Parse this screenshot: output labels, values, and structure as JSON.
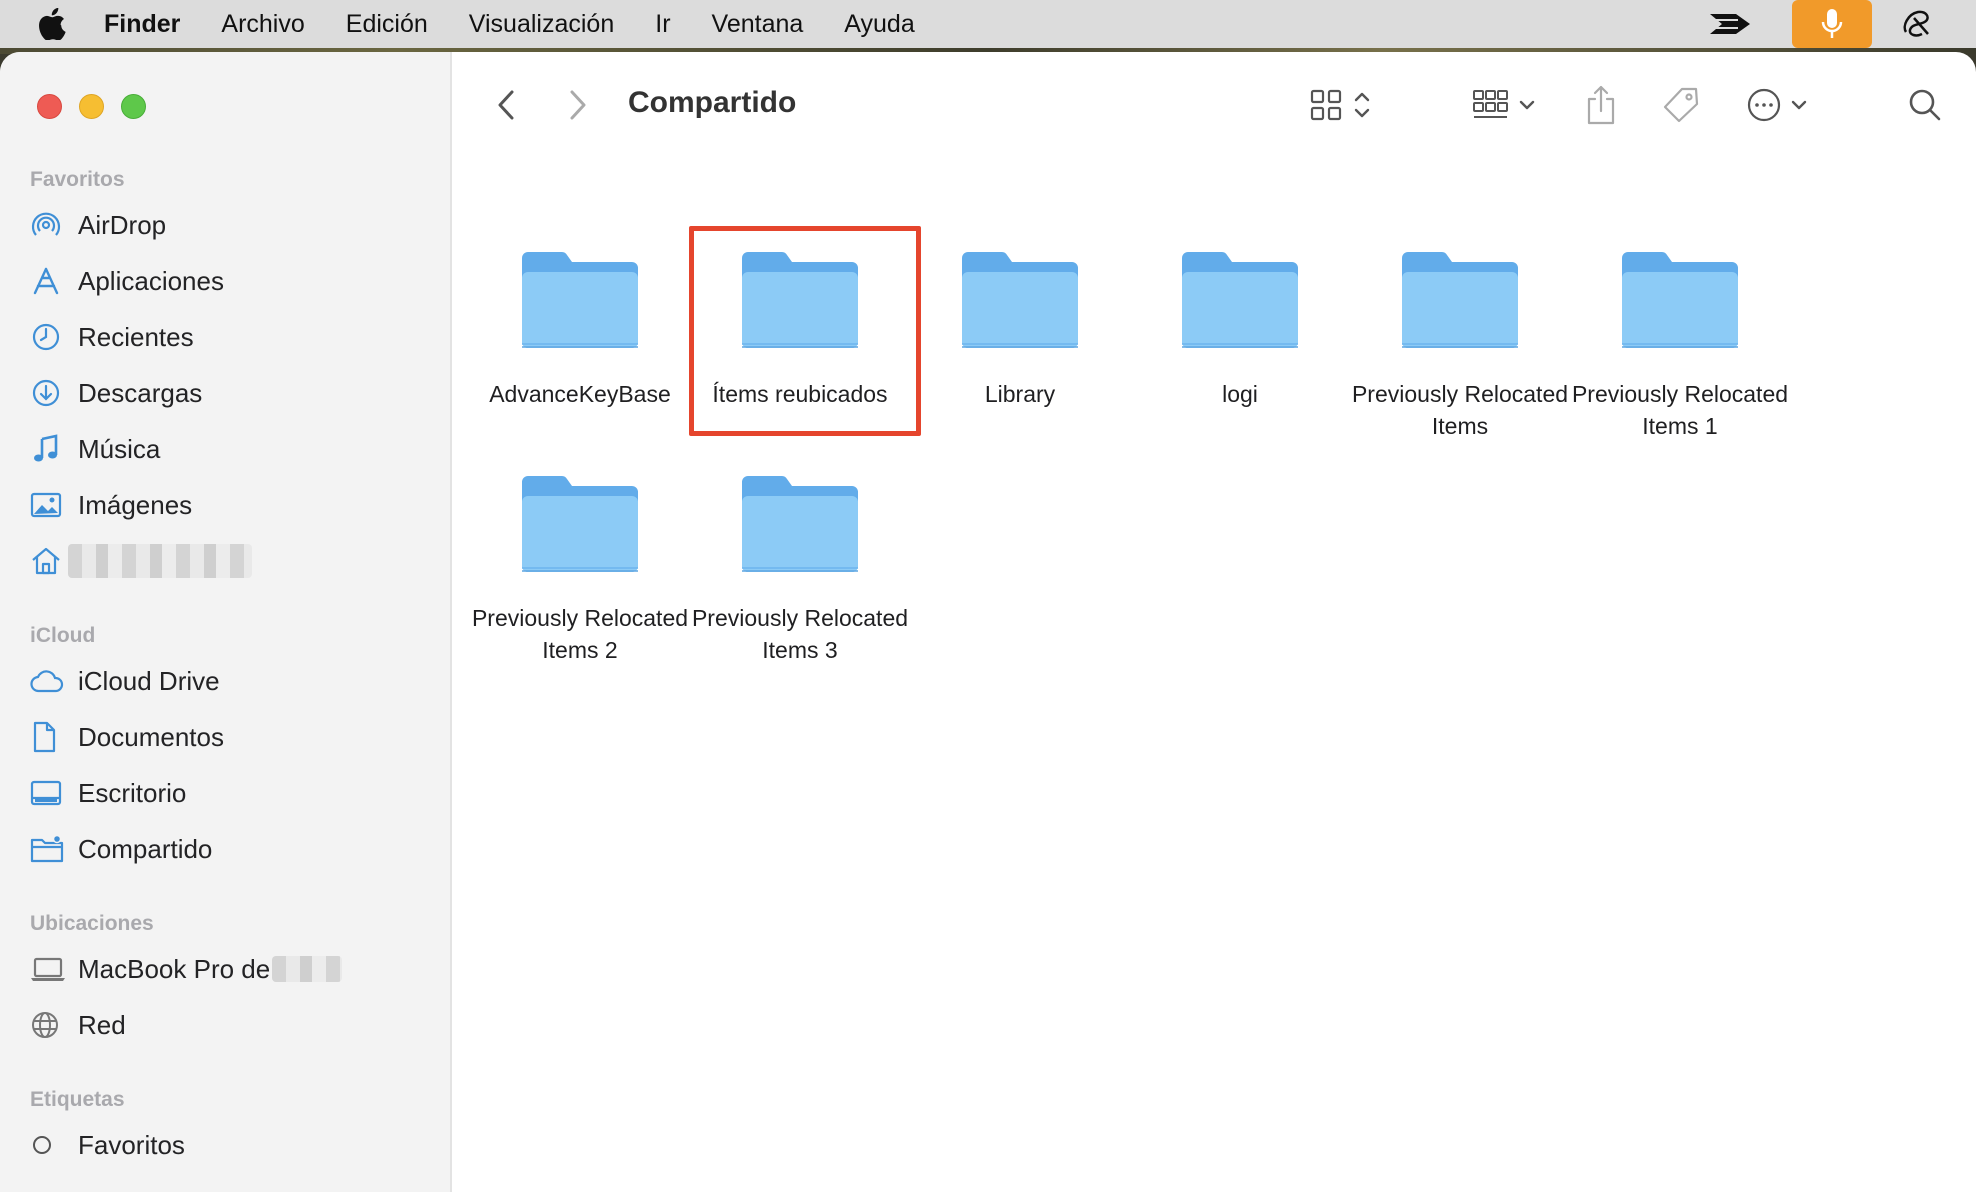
{
  "menubar": {
    "app": "Finder",
    "items": [
      "Archivo",
      "Edición",
      "Visualización",
      "Ir",
      "Ventana",
      "Ayuda"
    ],
    "accent": "#f19a2a"
  },
  "window": {
    "title": "Compartido"
  },
  "sidebar": {
    "sections": {
      "favoritos": "Favoritos",
      "icloud": "iCloud",
      "ubicaciones": "Ubicaciones",
      "etiquetas": "Etiquetas"
    },
    "favoritos": [
      {
        "label": "AirDrop",
        "icon": "airdrop-icon"
      },
      {
        "label": "Aplicaciones",
        "icon": "applications-icon"
      },
      {
        "label": "Recientes",
        "icon": "clock-icon"
      },
      {
        "label": "Descargas",
        "icon": "download-icon"
      },
      {
        "label": "Música",
        "icon": "music-icon"
      },
      {
        "label": "Imágenes",
        "icon": "photos-icon"
      },
      {
        "label": "",
        "icon": "home-icon"
      }
    ],
    "icloud": [
      {
        "label": "iCloud Drive",
        "icon": "cloud-icon"
      },
      {
        "label": "Documentos",
        "icon": "document-icon"
      },
      {
        "label": "Escritorio",
        "icon": "desktop-icon"
      },
      {
        "label": "Compartido",
        "icon": "shared-folder-icon"
      }
    ],
    "ubicaciones": [
      {
        "label": "MacBook Pro de",
        "icon": "laptop-icon"
      },
      {
        "label": "Red",
        "icon": "globe-icon"
      }
    ],
    "etiquetas": [
      {
        "label": "Favoritos",
        "icon": "tag-circle-icon"
      }
    ]
  },
  "folders": [
    {
      "label": "AdvanceKeyBase"
    },
    {
      "label": "Ítems reubicados",
      "highlighted": true
    },
    {
      "label": "Library"
    },
    {
      "label": "logi"
    },
    {
      "label": "Previously Relocated Items"
    },
    {
      "label": "Previously Relocated Items 1"
    },
    {
      "label": "Previously Relocated Items 2"
    },
    {
      "label": "Previously Relocated Items 3"
    }
  ],
  "colors": {
    "folder_body": "#8ccbf6",
    "folder_back": "#62acea",
    "highlight": "#e5452d",
    "sidebar_icon": "#3f8fd6"
  }
}
